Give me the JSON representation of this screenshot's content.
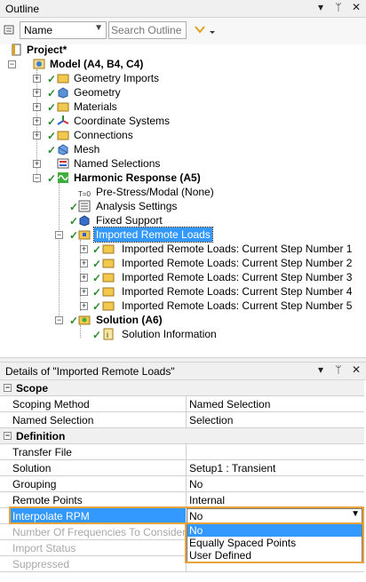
{
  "outline": {
    "title": "Outline",
    "header_icons": [
      "chevron-down-icon",
      "pin-icon",
      "close-icon"
    ],
    "filter_select": "Name",
    "search_placeholder": "Search Outline",
    "tree": {
      "project": "Project*",
      "model": "Model (A4, B4, C4)",
      "geometry_imports": "Geometry Imports",
      "geometry": "Geometry",
      "materials": "Materials",
      "coordinate_systems": "Coordinate Systems",
      "connections": "Connections",
      "mesh": "Mesh",
      "named_selections": "Named Selections",
      "harmonic_response": "Harmonic Response (A5)",
      "pre_stress": "Pre-Stress/Modal (None)",
      "analysis_settings": "Analysis Settings",
      "fixed_support": "Fixed Support",
      "imported_remote_loads": "Imported Remote Loads",
      "steps": [
        "Imported Remote Loads: Current Step Number 1",
        "Imported Remote Loads: Current Step Number 2",
        "Imported Remote Loads: Current Step Number 3",
        "Imported Remote Loads: Current Step Number 4",
        "Imported Remote Loads: Current Step Number 5"
      ],
      "solution": "Solution (A6)",
      "solution_information": "Solution Information"
    }
  },
  "details": {
    "title": "Details of \"Imported Remote Loads\"",
    "scope_group": "Scope",
    "definition_group": "Definition",
    "rows": {
      "scoping_method": {
        "label": "Scoping Method",
        "value": "Named Selection"
      },
      "named_selection": {
        "label": "Named Selection",
        "value": "Selection"
      },
      "transfer_file": {
        "label": "Transfer File",
        "value": ""
      },
      "solution": {
        "label": "Solution",
        "value": "Setup1 : Transient"
      },
      "grouping": {
        "label": "Grouping",
        "value": "No"
      },
      "remote_points": {
        "label": "Remote Points",
        "value": "Internal"
      },
      "interpolate_rpm": {
        "label": "Interpolate RPM",
        "value": "No"
      },
      "num_frequencies": {
        "label": "Number Of Frequencies To Consider",
        "value": ""
      },
      "import_status": {
        "label": "Import Status",
        "value": ""
      },
      "suppressed": {
        "label": "Suppressed",
        "value": ""
      }
    },
    "dropdown_options": [
      "No",
      "Equally Spaced Points",
      "User Defined"
    ]
  },
  "colors": {
    "selection": "#3399ff",
    "highlight_box": "#e8a33d",
    "check": "#2a8c2a"
  }
}
